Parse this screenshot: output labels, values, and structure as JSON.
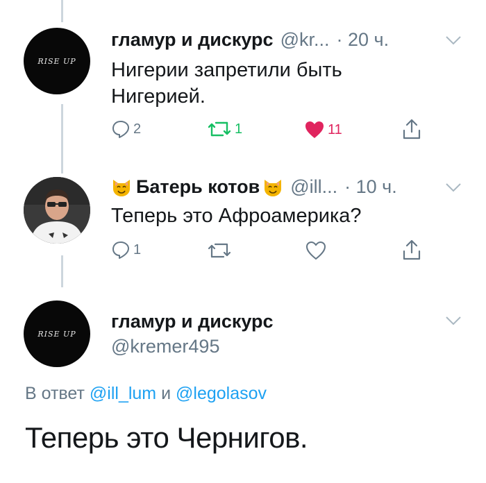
{
  "tweets": [
    {
      "avatar_text": "RISE UP",
      "name": "гламур и дискурс",
      "handle": "@kr...",
      "time": "· 20 ч.",
      "text_lines": [
        "Нигерии запретили быть",
        "Нигерией."
      ],
      "reply_count": "2",
      "retweet_count": "1",
      "like_count": "11"
    },
    {
      "name": "Батерь котов",
      "handle": "@ill...",
      "time": "· 10 ч.",
      "text_lines": [
        "Теперь это Афроамерика?"
      ],
      "reply_count": "1"
    }
  ],
  "main": {
    "avatar_text": "RISE UP",
    "name": "гламур и дискурс",
    "handle": "@kremer495",
    "reply_prefix": "В ответ",
    "mention_1": "@ill_lum",
    "conj": "и",
    "mention_2": "@legolasov",
    "text": "Теперь это Чернигов."
  },
  "colors": {
    "like": "#e0245e",
    "retweet": "#17bf63",
    "link": "#1da1f2",
    "muted": "#657786"
  }
}
